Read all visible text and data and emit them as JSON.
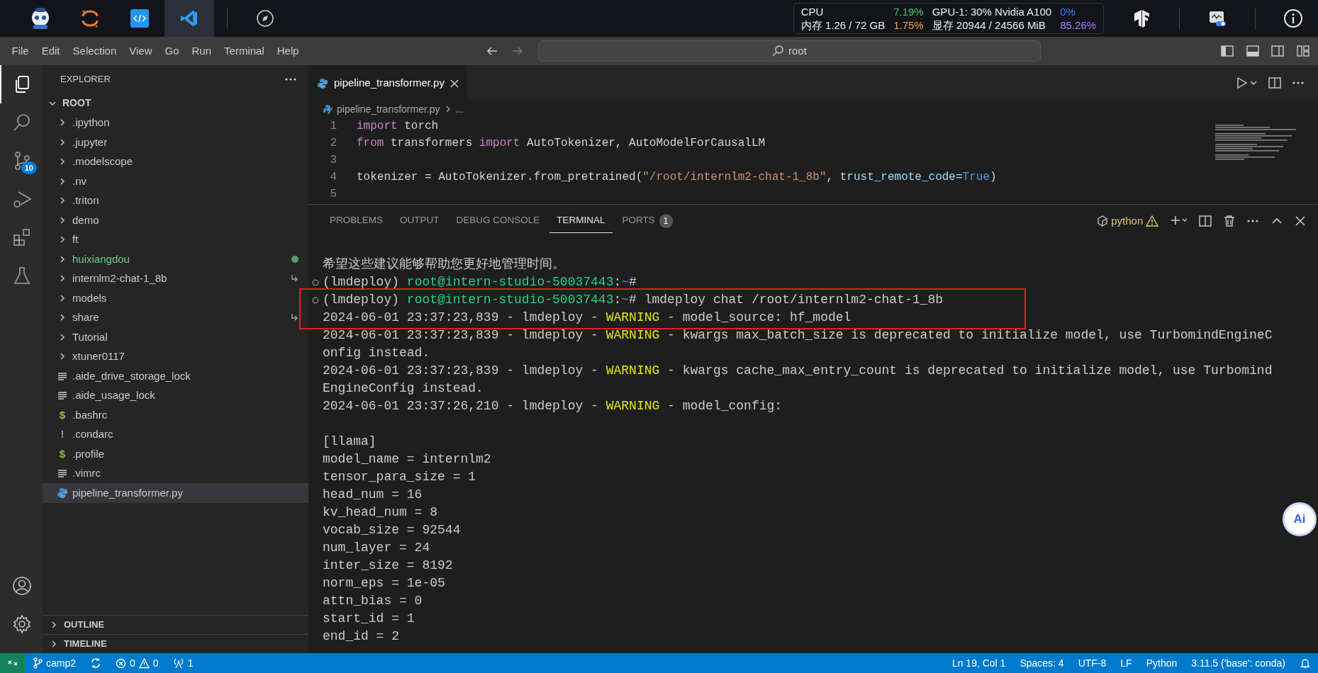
{
  "topbar": {
    "apps": [
      {
        "kind": "mascot",
        "selected": false
      },
      {
        "kind": "ring",
        "selected": false
      },
      {
        "kind": "code",
        "selected": false
      },
      {
        "kind": "vscode",
        "selected": true
      },
      {
        "kind": "compass",
        "selected": false
      }
    ],
    "metrics": {
      "cpu_label": "CPU",
      "cpu_value": "7.19%",
      "mem_label": "内存 1.26 / 72 GB",
      "mem_value": "1.75%",
      "gpu_label": "GPU-1: 30% Nvidia A100",
      "gpu_value": "0%",
      "vram_label": "显存 20944 / 24566 MiB",
      "vram_value": "85.26%"
    }
  },
  "menu": [
    "File",
    "Edit",
    "Selection",
    "View",
    "Go",
    "Run",
    "Terminal",
    "Help"
  ],
  "command_center": {
    "label": "root"
  },
  "activity_bar": {
    "items": [
      {
        "kind": "explorer",
        "selected": true
      },
      {
        "kind": "search",
        "selected": false
      },
      {
        "kind": "source-control",
        "selected": false,
        "badge": "10"
      },
      {
        "kind": "run-debug",
        "selected": false
      },
      {
        "kind": "extensions",
        "selected": false
      },
      {
        "kind": "testing",
        "selected": false
      }
    ],
    "bottom": [
      {
        "kind": "account"
      },
      {
        "kind": "settings"
      }
    ]
  },
  "explorer": {
    "title": "EXPLORER",
    "root": "ROOT",
    "items": [
      {
        "label": ".ipython",
        "kind": "folder",
        "selected": false,
        "color": "#cccccc",
        "modified": false,
        "symlink": false
      },
      {
        "label": ".jupyter",
        "kind": "folder",
        "selected": false,
        "color": "#cccccc",
        "modified": false,
        "symlink": false
      },
      {
        "label": ".modelscope",
        "kind": "folder",
        "selected": false,
        "color": "#cccccc",
        "modified": false,
        "symlink": false
      },
      {
        "label": ".nv",
        "kind": "folder",
        "selected": false,
        "color": "#cccccc",
        "modified": false,
        "symlink": false
      },
      {
        "label": ".triton",
        "kind": "folder",
        "selected": false,
        "color": "#cccccc",
        "modified": false,
        "symlink": false
      },
      {
        "label": "demo",
        "kind": "folder",
        "selected": false,
        "color": "#cccccc",
        "modified": false,
        "symlink": false
      },
      {
        "label": "ft",
        "kind": "folder",
        "selected": false,
        "color": "#cccccc",
        "modified": false,
        "symlink": false
      },
      {
        "label": "huixiangdou",
        "kind": "folder",
        "selected": false,
        "color": "#73c991",
        "modified": true,
        "symlink": false
      },
      {
        "label": "internlm2-chat-1_8b",
        "kind": "folder",
        "selected": false,
        "color": "#cccccc",
        "modified": false,
        "symlink": true
      },
      {
        "label": "models",
        "kind": "folder",
        "selected": false,
        "color": "#cccccc",
        "modified": false,
        "symlink": false
      },
      {
        "label": "share",
        "kind": "folder",
        "selected": false,
        "color": "#cccccc",
        "modified": false,
        "symlink": true
      },
      {
        "label": "Tutorial",
        "kind": "folder",
        "selected": false,
        "color": "#cccccc",
        "modified": false,
        "symlink": false
      },
      {
        "label": "xtuner0117",
        "kind": "folder",
        "selected": false,
        "color": "#cccccc",
        "modified": false,
        "symlink": false
      },
      {
        "label": ".aide_drive_storage_lock",
        "kind": "text",
        "selected": false,
        "color": "#cccccc",
        "modified": false,
        "symlink": false
      },
      {
        "label": ".aide_usage_lock",
        "kind": "text",
        "selected": false,
        "color": "#cccccc",
        "modified": false,
        "symlink": false
      },
      {
        "label": ".bashrc",
        "kind": "glyph",
        "glyph": "$",
        "selected": false,
        "color": "#cccccc",
        "modified": false,
        "symlink": false
      },
      {
        "label": ".condarc",
        "kind": "glyph",
        "glyph": "!",
        "selected": false,
        "color": "#cccccc",
        "modified": false,
        "symlink": false
      },
      {
        "label": ".profile",
        "kind": "glyph",
        "glyph": "$",
        "selected": false,
        "color": "#cccccc",
        "modified": false,
        "symlink": false
      },
      {
        "label": ".vimrc",
        "kind": "text",
        "selected": false,
        "color": "#cccccc",
        "modified": false,
        "symlink": false
      },
      {
        "label": "pipeline_transformer.py",
        "kind": "python",
        "selected": true,
        "color": "#cccccc",
        "modified": false,
        "symlink": false
      }
    ],
    "sections": [
      "OUTLINE",
      "TIMELINE"
    ]
  },
  "editor": {
    "tab": {
      "label": "pipeline_transformer.py",
      "selected": true
    },
    "breadcrumb": {
      "file": "pipeline_transformer.py",
      "more": "..."
    },
    "lines": [
      {
        "number": "1",
        "tokens": [
          {
            "t": "import",
            "kind": "kw"
          },
          {
            "t": " torch",
            "kind": "text"
          }
        ]
      },
      {
        "number": "2",
        "tokens": [
          {
            "t": "from",
            "kind": "kw"
          },
          {
            "t": " transformers ",
            "kind": "text"
          },
          {
            "t": "import",
            "kind": "kw"
          },
          {
            "t": " AutoTokenizer, AutoModelForCausalLM",
            "kind": "text"
          }
        ]
      },
      {
        "number": "3"
      },
      {
        "number": "4",
        "tokens": [
          {
            "t": "tokenizer = AutoTokenizer.from_pretrained(",
            "kind": "text"
          },
          {
            "t": "\"/root/internlm2-chat-1_8b\"",
            "kind": "str"
          },
          {
            "t": ", ",
            "kind": "text"
          },
          {
            "t": "trust_remote_code",
            "kind": "param"
          },
          {
            "t": "=",
            "kind": "text"
          },
          {
            "t": "True",
            "kind": "const"
          },
          {
            "t": ")",
            "kind": "text"
          }
        ]
      },
      {
        "number": "5"
      }
    ]
  },
  "panel": {
    "tabs": [
      {
        "label": "PROBLEMS",
        "selected": false
      },
      {
        "label": "OUTPUT",
        "selected": false
      },
      {
        "label": "DEBUG CONSOLE",
        "selected": false
      },
      {
        "label": "TERMINAL",
        "selected": true
      },
      {
        "label": "PORTS",
        "selected": false,
        "badge": "1"
      }
    ],
    "terminal_name": "python",
    "terminal": [
      {
        "kind": "text",
        "highlighted": false,
        "segments": [
          {
            "text": "希望这些建议能够帮助您更好地管理时间。",
            "kind": "plain"
          }
        ]
      },
      {
        "kind": "prompt",
        "highlighted": false,
        "segments": [
          {
            "text": "(lmdeploy) ",
            "kind": "plain"
          },
          {
            "text": "root@intern-studio-50037443",
            "kind": "user"
          },
          {
            "text": ":",
            "kind": "plain"
          },
          {
            "text": "~",
            "kind": "path"
          },
          {
            "text": "#",
            "kind": "plain"
          }
        ]
      },
      {
        "kind": "prompt",
        "highlighted": true,
        "segments": [
          {
            "text": "(lmdeploy) ",
            "kind": "plain"
          },
          {
            "text": "root@intern-studio-50037443",
            "kind": "user"
          },
          {
            "text": ":",
            "kind": "plain"
          },
          {
            "text": "~",
            "kind": "path"
          },
          {
            "text": "# lmdeploy chat /root/internlm2-chat-1_8b",
            "kind": "plain"
          }
        ]
      },
      {
        "kind": "text",
        "highlighted": true,
        "segments": [
          {
            "text": "2024-06-01 23:37:23,839 - lmdeploy - ",
            "kind": "plain"
          },
          {
            "text": "WARNING",
            "kind": "warning"
          },
          {
            "text": " - model_source: hf_model",
            "kind": "plain"
          }
        ]
      },
      {
        "kind": "text",
        "highlighted": false,
        "segments": [
          {
            "text": "2024-06-01 23:37:23,839 - lmdeploy - ",
            "kind": "plain"
          },
          {
            "text": "WARNING",
            "kind": "warning"
          },
          {
            "text": " - kwargs max_batch_size is deprecated to initialize model, use TurbomindEngineC",
            "kind": "plain"
          }
        ]
      },
      {
        "kind": "text",
        "highlighted": false,
        "segments": [
          {
            "text": "onfig instead.",
            "kind": "plain"
          }
        ]
      },
      {
        "kind": "text",
        "highlighted": false,
        "segments": [
          {
            "text": "2024-06-01 23:37:23,839 - lmdeploy - ",
            "kind": "plain"
          },
          {
            "text": "WARNING",
            "kind": "warning"
          },
          {
            "text": " - kwargs cache_max_entry_count is deprecated to initialize model, use Turbomind",
            "kind": "plain"
          }
        ]
      },
      {
        "kind": "text",
        "highlighted": false,
        "segments": [
          {
            "text": "EngineConfig instead.",
            "kind": "plain"
          }
        ]
      },
      {
        "kind": "text",
        "highlighted": false,
        "segments": [
          {
            "text": "2024-06-01 23:37:26,210 - lmdeploy - ",
            "kind": "plain"
          },
          {
            "text": "WARNING",
            "kind": "warning"
          },
          {
            "text": " - model_config:",
            "kind": "plain"
          }
        ]
      },
      {
        "kind": "blank"
      },
      {
        "kind": "text",
        "highlighted": false,
        "segments": [
          {
            "text": "[llama]",
            "kind": "plain"
          }
        ]
      },
      {
        "kind": "text",
        "highlighted": false,
        "segments": [
          {
            "text": "model_name = internlm2",
            "kind": "plain"
          }
        ]
      },
      {
        "kind": "text",
        "highlighted": false,
        "segments": [
          {
            "text": "tensor_para_size = 1",
            "kind": "plain"
          }
        ]
      },
      {
        "kind": "text",
        "highlighted": false,
        "segments": [
          {
            "text": "head_num = 16",
            "kind": "plain"
          }
        ]
      },
      {
        "kind": "text",
        "highlighted": false,
        "segments": [
          {
            "text": "kv_head_num = 8",
            "kind": "plain"
          }
        ]
      },
      {
        "kind": "text",
        "highlighted": false,
        "segments": [
          {
            "text": "vocab_size = 92544",
            "kind": "plain"
          }
        ]
      },
      {
        "kind": "text",
        "highlighted": false,
        "segments": [
          {
            "text": "num_layer = 24",
            "kind": "plain"
          }
        ]
      },
      {
        "kind": "text",
        "highlighted": false,
        "segments": [
          {
            "text": "inter_size = 8192",
            "kind": "plain"
          }
        ]
      },
      {
        "kind": "text",
        "highlighted": false,
        "segments": [
          {
            "text": "norm_eps = 1e-05",
            "kind": "plain"
          }
        ]
      },
      {
        "kind": "text",
        "highlighted": false,
        "segments": [
          {
            "text": "attn_bias = 0",
            "kind": "plain"
          }
        ]
      },
      {
        "kind": "text",
        "highlighted": false,
        "segments": [
          {
            "text": "start_id = 1",
            "kind": "plain"
          }
        ]
      },
      {
        "kind": "text",
        "highlighted": false,
        "segments": [
          {
            "text": "end_id = 2",
            "kind": "plain"
          }
        ]
      }
    ]
  },
  "ai_button": {
    "label": "Ai"
  },
  "status_bar": {
    "branch": "camp2",
    "errors": "0",
    "warnings": "0",
    "ports": "1",
    "items": [
      "Ln 19, Col 1",
      "Spaces: 4",
      "UTF-8",
      "LF",
      "Python",
      "3.11.5 ('base': conda)"
    ]
  }
}
